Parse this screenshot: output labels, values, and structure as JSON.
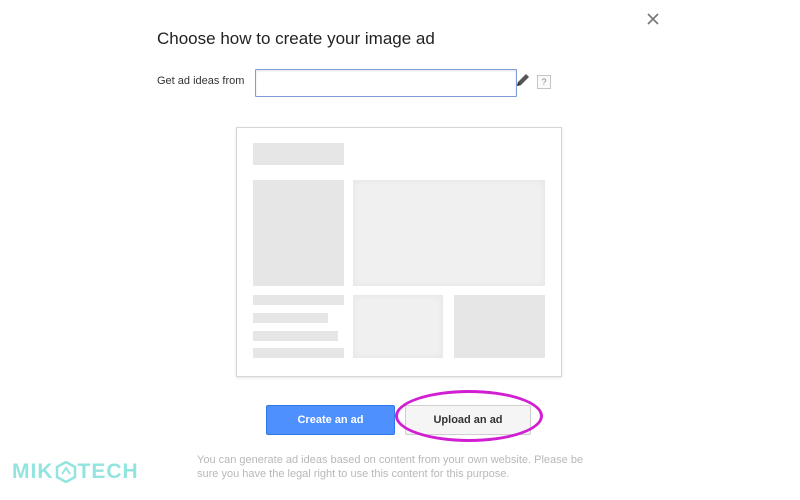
{
  "dialog": {
    "title": "Choose how to create your image ad",
    "field_label": "Get ad ideas from",
    "url_value": "",
    "help_label": "?"
  },
  "actions": {
    "create_label": "Create an ad",
    "upload_label": "Upload an ad"
  },
  "note": "You can generate ad ideas based on content from your own website. Please be sure you have the legal right to use this content for this purpose.",
  "watermark": {
    "part1": "MIK",
    "part2": "TECH"
  },
  "icons": {
    "close": "close-icon",
    "edit": "pencil-icon",
    "help": "help-icon"
  },
  "colors": {
    "primary": "#4d90fe",
    "highlight": "#d21ed2",
    "watermark": "#8ee3de"
  }
}
